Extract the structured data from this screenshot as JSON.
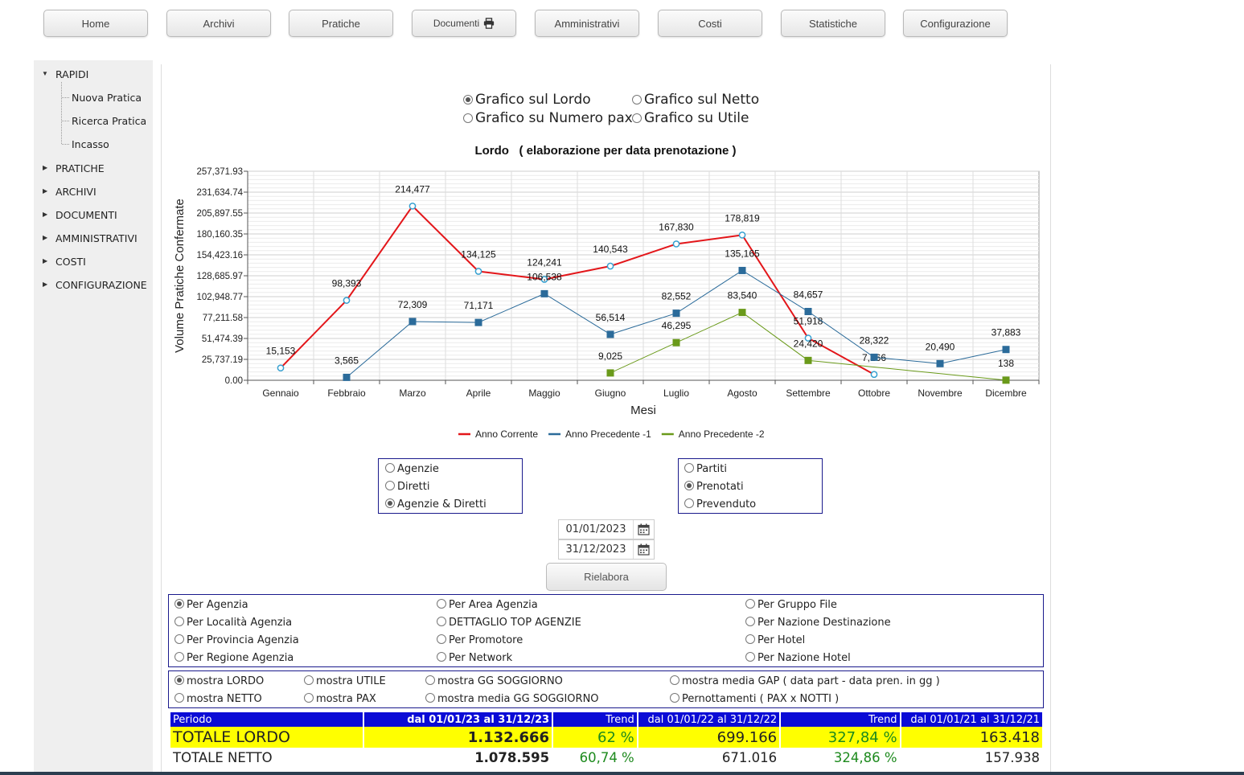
{
  "nav": {
    "buttons": [
      "Home",
      "Archivi",
      "Pratiche",
      "Documenti",
      "Amministrativi",
      "Costi",
      "Statistiche",
      "Configurazione"
    ]
  },
  "sidebar": {
    "root": "RAPIDI",
    "rapidi_items": [
      "Nuova Pratica",
      "Ricerca Pratica",
      "Incasso"
    ],
    "sections": [
      "PRATICHE",
      "ARCHIVI",
      "DOCUMENTI",
      "AMMINISTRATIVI",
      "COSTI",
      "CONFIGURAZIONE"
    ]
  },
  "chart_mode": {
    "lordo": "Grafico sul Lordo",
    "netto": "Grafico sul Netto",
    "pax": "Grafico su Numero pax",
    "utile": "Grafico su Utile",
    "selected": "lordo"
  },
  "chart_data": {
    "type": "line",
    "title": "Lordo   ( elaborazione per data prenotazione )",
    "xlabel": "Mesi",
    "ylabel": "Volume Pratiche Confermate",
    "categories": [
      "Gennaio",
      "Febbraio",
      "Marzo",
      "Aprile",
      "Maggio",
      "Giugno",
      "Luglio",
      "Agosto",
      "Settembre",
      "Ottobre",
      "Novembre",
      "Dicembre"
    ],
    "yticks": [
      "0.00",
      "25,737.19",
      "51,474.39",
      "77,211.58",
      "102,948.77",
      "128,685.97",
      "154,423.16",
      "180,160.35",
      "205,897.55",
      "231,634.74",
      "257,371.93"
    ],
    "ylim": [
      0,
      257371.93
    ],
    "grid": true,
    "legend_position": "bottom",
    "series": [
      {
        "name": "Anno Corrente",
        "color": "#e3161a",
        "marker": "circle",
        "width": 2,
        "values": [
          15153,
          98393,
          214477,
          134125,
          124241,
          140543,
          167830,
          178819,
          51918,
          7166,
          null,
          null
        ],
        "labels": [
          "15,153",
          "98,393",
          "214,477",
          "134,125",
          "124,241",
          "140,543",
          "167,830",
          "178,819",
          "51,918",
          "7,166",
          null,
          null
        ]
      },
      {
        "name": "Anno Precedente -1",
        "color": "#2b6b9a",
        "marker": "square",
        "width": 1,
        "values": [
          null,
          3565,
          72309,
          71171,
          106538,
          56514,
          82552,
          135165,
          84657,
          28322,
          20490,
          37883
        ],
        "labels": [
          null,
          "3,565",
          "72,309",
          "71,171",
          "106,538",
          "56,514",
          "82,552",
          "135,165",
          "84,657",
          "28,322",
          "20,490",
          "37,883"
        ]
      },
      {
        "name": "Anno Precedente -2",
        "color": "#6a9a1a",
        "marker": "square",
        "width": 1,
        "values": [
          null,
          null,
          null,
          null,
          null,
          9025,
          46295,
          83540,
          24420,
          null,
          null,
          138
        ],
        "labels": [
          null,
          null,
          null,
          null,
          null,
          "9,025",
          "46,295",
          "83,540",
          "24,420",
          null,
          null,
          "138"
        ]
      }
    ]
  },
  "filters": {
    "tipo": {
      "options": [
        "Agenzie",
        "Diretti",
        "Agenzie & Diretti"
      ],
      "selected": 2
    },
    "stato": {
      "options": [
        "Partiti",
        "Prenotati",
        "Prevenduto"
      ],
      "selected": 1
    },
    "date_from": "01/01/2023",
    "date_to": "31/12/2023",
    "rielabora": "Rielabora"
  },
  "grouping": {
    "options": [
      "Per Agenzia",
      "Per Località Agenzia",
      "Per Provincia Agenzia",
      "Per Regione Agenzia",
      "Per Area Agenzia",
      "DETTAGLIO TOP AGENZIE",
      "Per Promotore",
      "Per Network",
      "Per Gruppo File",
      "Per Nazione Destinazione",
      "Per Hotel",
      "Per Nazione Hotel"
    ],
    "selected": 0
  },
  "display": {
    "options": [
      "mostra LORDO",
      "mostra NETTO",
      "mostra UTILE",
      "mostra PAX",
      "mostra GG SOGGIORNO",
      "mostra media GG SOGGIORNO",
      "mostra media GAP ( data part - data pren. in gg )",
      "Pernottamenti ( PAX x NOTTI )"
    ],
    "selected": 0
  },
  "summary": {
    "headers": [
      "Periodo",
      "dal 01/01/23 al 31/12/23",
      "Trend",
      "dal 01/01/22 al 31/12/22",
      "Trend",
      "dal 01/01/21 al 31/12/21"
    ],
    "rows": [
      {
        "label": "TOTALE LORDO",
        "v1": "1.132.666",
        "t1": "62 %",
        "v2": "699.166",
        "t2": "327,84 %",
        "v3": "163.418"
      },
      {
        "label": "TOTALE NETTO",
        "v1": "1.078.595",
        "t1": "60,74 %",
        "v2": "671.016",
        "t2": "324,86 %",
        "v3": "157.938"
      }
    ]
  }
}
